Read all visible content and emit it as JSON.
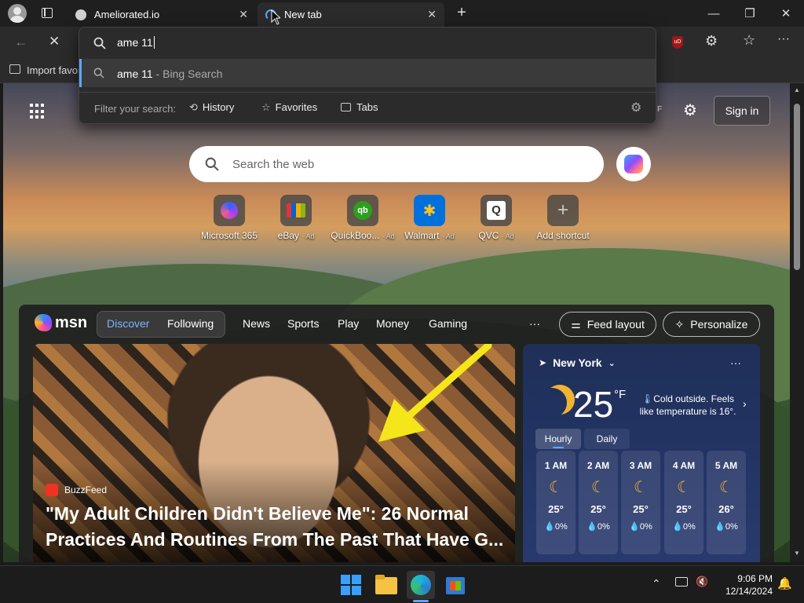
{
  "tabs": [
    {
      "title": "Ameliorated.io",
      "close": "✕"
    },
    {
      "title": "New tab",
      "close": "✕"
    }
  ],
  "omnibox": {
    "query": "ame 11",
    "suggestion_main": "ame 11",
    "suggestion_suffix": " - Bing Search",
    "filter_label": "Filter your search:",
    "filters": [
      "History",
      "Favorites",
      "Tabs"
    ]
  },
  "favbar": {
    "import_label": "Import favor"
  },
  "page": {
    "temp_unit_fragment": "F",
    "sign_in": "Sign in",
    "search_placeholder": "Search the web",
    "quick_links": [
      {
        "label": "Microsoft 365",
        "ad": ""
      },
      {
        "label": "eBay",
        "ad": "· Ad"
      },
      {
        "label": "QuickBoo...",
        "ad": "· Ad"
      },
      {
        "label": "Walmart",
        "ad": "· Ad"
      },
      {
        "label": "QVC",
        "ad": "· Ad"
      },
      {
        "label": "Add shortcut",
        "ad": ""
      }
    ],
    "msn_logo": "msn",
    "nav": {
      "discover": "Discover",
      "following": "Following",
      "links": [
        "News",
        "Sports",
        "Play",
        "Money",
        "Gaming"
      ],
      "more": "···",
      "feed_layout": "Feed layout",
      "personalize": "Personalize"
    },
    "article": {
      "source": "BuzzFeed",
      "headline_line1": "\"My Adult Children Didn't Believe Me\": 26 Normal",
      "headline_line2": "Practices And Routines From The Past That Have G..."
    },
    "weather": {
      "location": "New York",
      "more": "···",
      "temp": "25",
      "unit": "°F",
      "note": "Cold outside. Feels like temperature is 16°.",
      "tab_hourly": "Hourly",
      "tab_daily": "Daily",
      "hours": [
        {
          "time": "1 AM",
          "temp": "25°",
          "precip": "0%"
        },
        {
          "time": "2 AM",
          "temp": "25°",
          "precip": "0%"
        },
        {
          "time": "3 AM",
          "temp": "25°",
          "precip": "0%"
        },
        {
          "time": "4 AM",
          "temp": "25°",
          "precip": "0%"
        },
        {
          "time": "5 AM",
          "temp": "26°",
          "precip": "0%"
        }
      ]
    }
  },
  "taskbar": {
    "time": "9:06 PM",
    "date": "12/14/2024"
  },
  "colors": {
    "accent": "#3b82f6",
    "moon": "#f2b233",
    "arrow": "#f5e51b"
  }
}
